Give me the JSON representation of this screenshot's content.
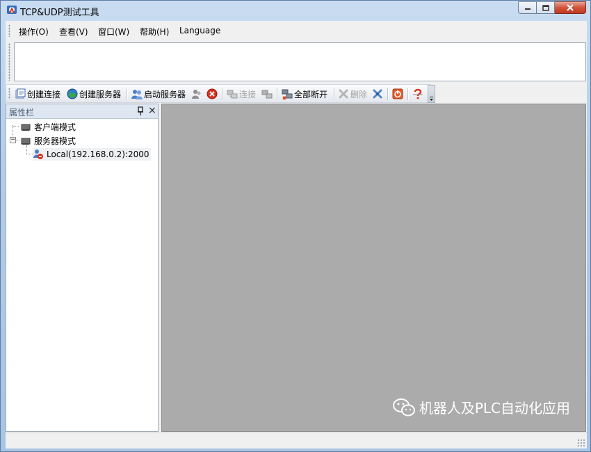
{
  "window": {
    "title": "TCP&UDP测试工具"
  },
  "menu": [
    {
      "label": "操作(O)"
    },
    {
      "label": "查看(V)"
    },
    {
      "label": "窗口(W)"
    },
    {
      "label": "帮助(H)"
    },
    {
      "label": "Language"
    }
  ],
  "toolbar": {
    "create_connection": "创建连接",
    "create_server": "创建服务器",
    "start_server": "启动服务器",
    "connect": "连接",
    "disconnect_all": "全部断开",
    "delete": "删除"
  },
  "panel": {
    "title": "属性栏",
    "close_glyph": "×"
  },
  "tree": {
    "client_mode": "客户端模式",
    "server_mode": "服务器模式",
    "server_entry": "Local(192.168.0.2):2000",
    "expander_glyph": "−"
  },
  "watermark": {
    "text": "机器人及PLC自动化应用"
  },
  "colors": {
    "workspace": "#ababab",
    "title_bar": "#b3cbe8",
    "close_button": "#c2391f"
  }
}
